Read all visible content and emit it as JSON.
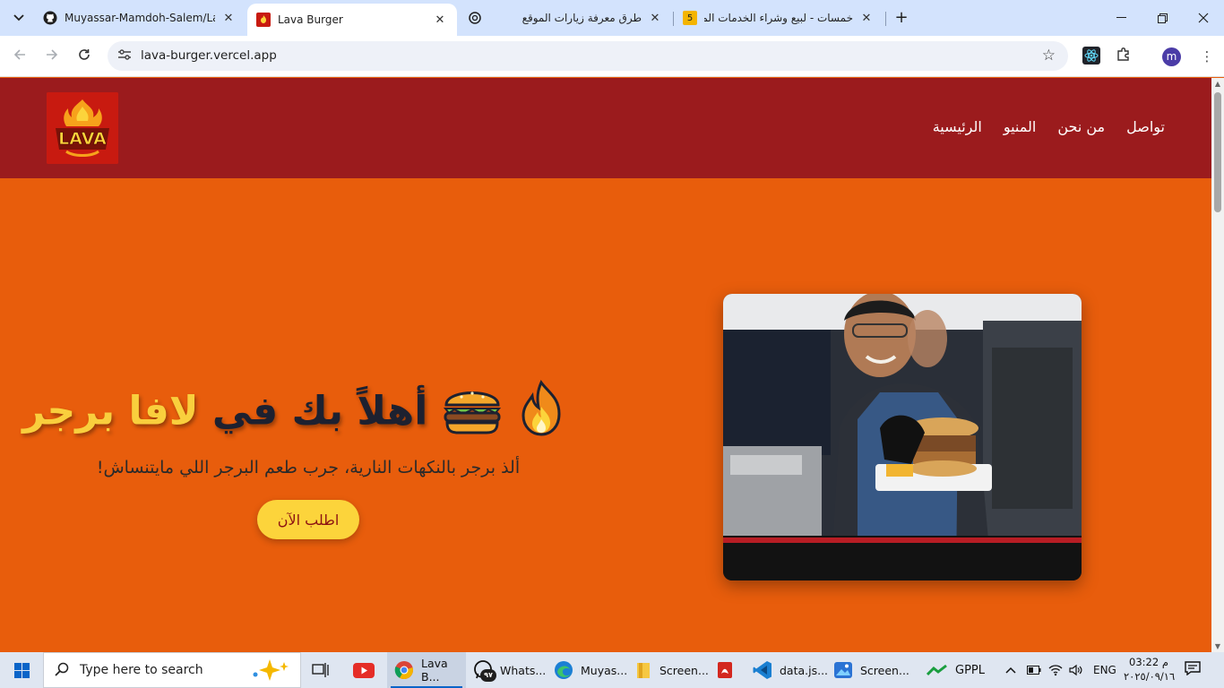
{
  "browser": {
    "tabs": [
      {
        "title": "Muyassar-Mamdoh-Salem/Lava",
        "icon": "github-icon",
        "active": false
      },
      {
        "title": "Lava Burger",
        "icon": "lava-favicon",
        "active": true
      },
      {
        "title": "طرق معرفة زيارات الموقع",
        "icon": "chatgpt-icon",
        "active": false
      },
      {
        "title": "خمسات - لبيع وشراء الخدمات المصغرة",
        "icon": "khamsat-icon",
        "active": false
      }
    ],
    "new_tab": "+",
    "url": "lava-burger.vercel.app",
    "profile_initial": "m",
    "colors": {
      "tabbar": "#d3e3fd",
      "omnibox": "#eef1f8"
    }
  },
  "site": {
    "nav": [
      "تواصل",
      "من نحن",
      "المنيو",
      "الرئيسية"
    ],
    "hero": {
      "title_prefix": "أهلاً بك في",
      "title_brand": "لافا برجر",
      "emojis": [
        "fire-emoji",
        "burger-emoji"
      ],
      "subtitle": "ألذ برجر بالنكهات النارية، جرب طعم البرجر اللي مايتنساش!",
      "cta": "اطلب الآن"
    },
    "logo_text": "LAVA",
    "colors": {
      "header": "#9b1b1d",
      "hero": "#e85d0c",
      "accent": "#f9cf3d",
      "cta_bg": "#fcd43b",
      "cta_text": "#8c1212",
      "title": "#1d2130"
    }
  },
  "taskbar": {
    "search_placeholder": "Type here to search",
    "apps": [
      {
        "label": "Lava B...",
        "icon": "chrome-icon"
      },
      {
        "label": "Whats...",
        "icon": "whatsapp-icon",
        "badge": "٩٧"
      },
      {
        "label": "Muyas...",
        "icon": "edge-icon"
      },
      {
        "label": "Screen...",
        "icon": "file-explorer-icon"
      },
      {
        "label": "",
        "icon": "pdf-icon"
      },
      {
        "label": "data.js...",
        "icon": "vscode-icon"
      },
      {
        "label": "Screen...",
        "icon": "photos-icon"
      }
    ],
    "tray_app": "GPPL",
    "language": "ENG",
    "time": "03:22 م",
    "date": "٢٠٢٥/٠٩/١٦"
  }
}
